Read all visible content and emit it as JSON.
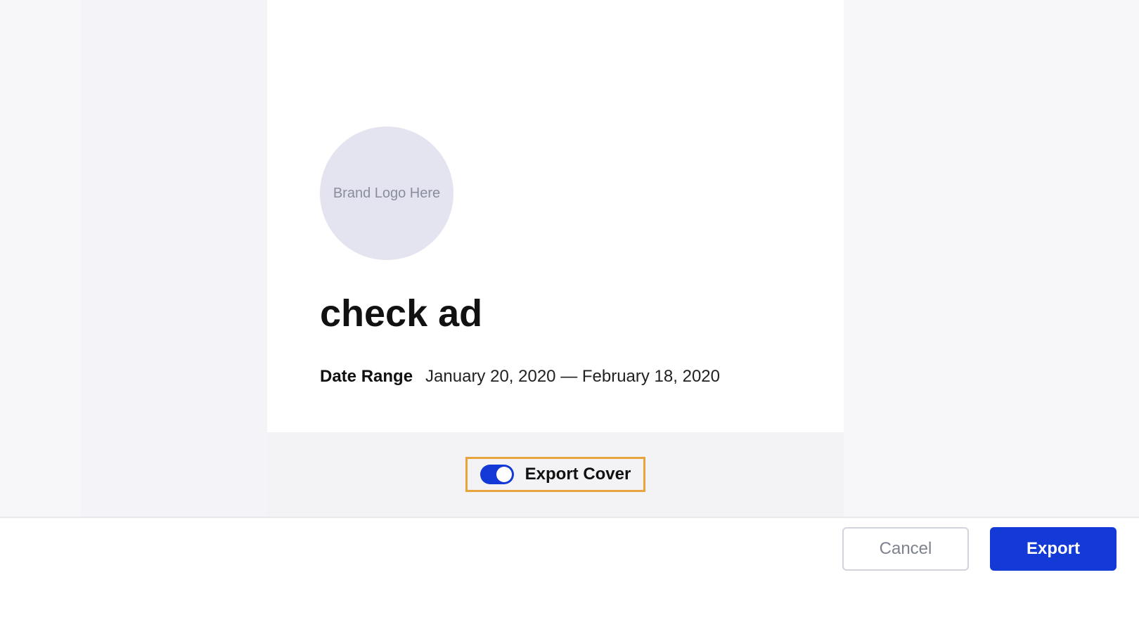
{
  "preview": {
    "logo_placeholder": "Brand Logo Here",
    "title": "check ad",
    "date_range_label": "Date Range",
    "date_range_value": "January 20, 2020 — February 18, 2020"
  },
  "toggle": {
    "label": "Export Cover",
    "on": true
  },
  "footer": {
    "cancel": "Cancel",
    "export": "Export"
  }
}
